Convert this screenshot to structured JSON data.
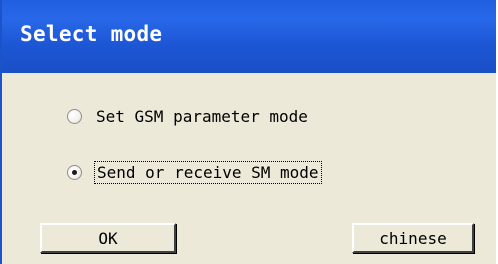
{
  "window": {
    "title": "Select mode"
  },
  "options": [
    {
      "label": "Set GSM parameter mode",
      "selected": false
    },
    {
      "label": "Send or receive SM mode",
      "selected": true
    }
  ],
  "buttons": {
    "ok_label": "OK",
    "chinese_label": "chinese"
  },
  "colors": {
    "titlebar": "#1d57d6",
    "client": "#ece9d8"
  }
}
